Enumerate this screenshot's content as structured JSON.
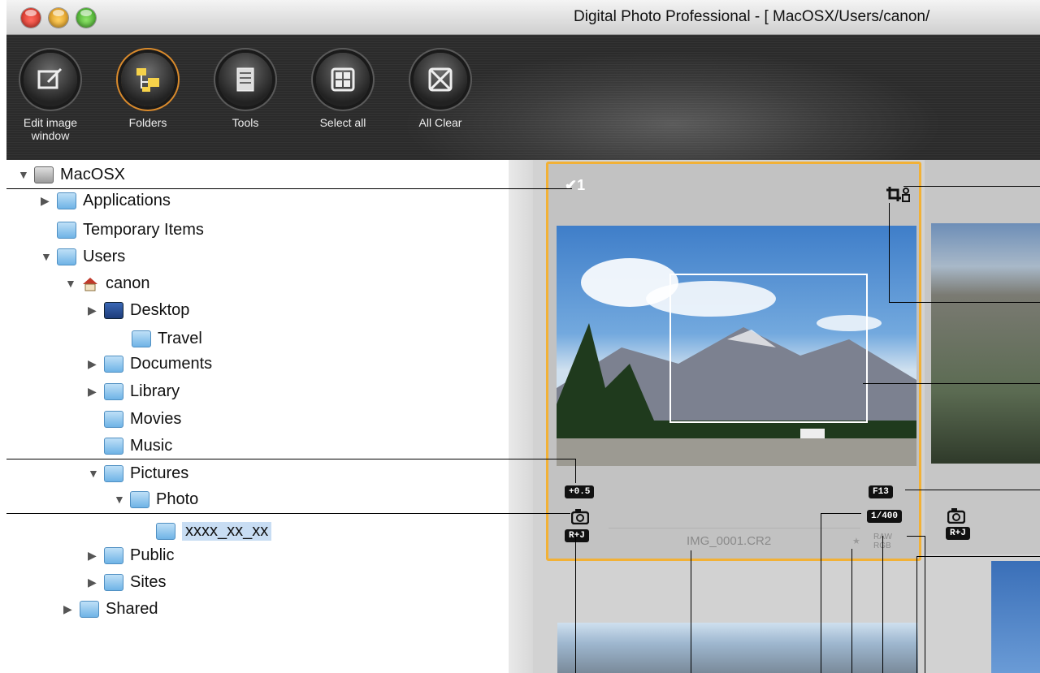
{
  "window": {
    "title": "Digital Photo Professional - [ MacOSX/Users/canon/"
  },
  "toolbar": {
    "buttons": [
      {
        "label_1": "Edit image",
        "label_2": "window"
      },
      {
        "label_1": "Folders",
        "label_2": ""
      },
      {
        "label_1": "Tools",
        "label_2": ""
      },
      {
        "label_1": "Select all",
        "label_2": ""
      },
      {
        "label_1": "All Clear",
        "label_2": ""
      }
    ]
  },
  "tree": {
    "items": [
      {
        "label": "MacOSX"
      },
      {
        "label": "Applications"
      },
      {
        "label": "Temporary Items"
      },
      {
        "label": "Users"
      },
      {
        "label": "canon"
      },
      {
        "label": "Desktop"
      },
      {
        "label": "Travel"
      },
      {
        "label": "Documents"
      },
      {
        "label": "Library"
      },
      {
        "label": "Movies"
      },
      {
        "label": "Music"
      },
      {
        "label": "Pictures"
      },
      {
        "label": "Photo"
      },
      {
        "label": "xxxx_xx_xx"
      },
      {
        "label": "Public"
      },
      {
        "label": "Sites"
      },
      {
        "label": "Shared"
      }
    ]
  },
  "thumbnail": {
    "filename": "IMG_0001.CR2",
    "exposure_comp": "+0.5",
    "aperture": "F13",
    "shutter": "1/400",
    "rj_badge": "R+J",
    "raw_label_1": "RAW",
    "raw_label_2": "RGB",
    "check_mark": "✔1",
    "star": "★"
  },
  "second_thumbnail": {
    "rj_badge": "R+J"
  },
  "colors": {
    "selection_border": "#f2b136",
    "toolbar_bg": "#2b2b2b"
  }
}
